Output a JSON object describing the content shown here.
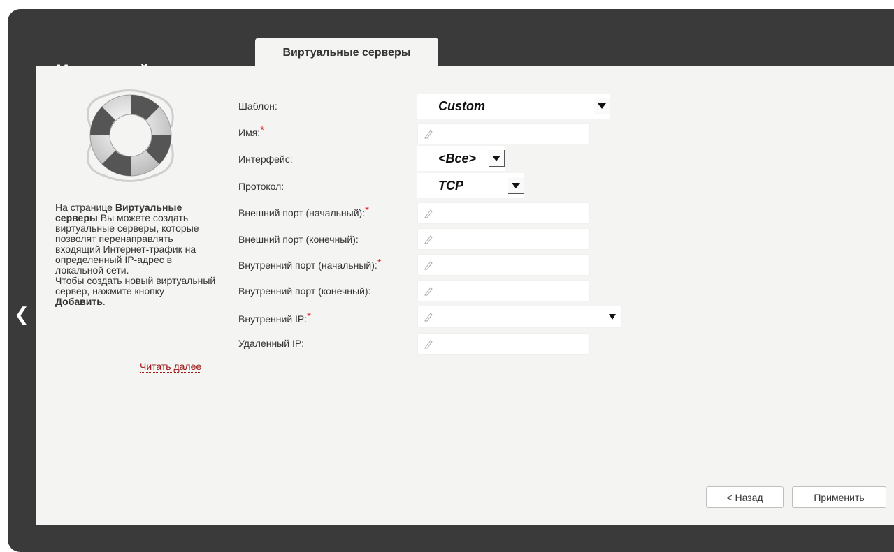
{
  "header": {
    "breadcrumb": "Межсетевой экран »",
    "tab_label": "Виртуальные серверы"
  },
  "sidebar": {
    "help_part1": "На странице ",
    "help_bold1": "Виртуальные серверы",
    "help_part2": " Вы можете создать виртуальные серверы, которые позволят перенаправлять входящий Интернет-трафик на определенный IP-адрес в локальной сети.",
    "help_part3": "Чтобы создать новый виртуальный сервер, нажмите кнопку ",
    "help_bold2": "Добавить",
    "help_part4": ".",
    "read_more": "Читать далее"
  },
  "form": {
    "template_label": "Шаблон:",
    "template_value": "Custom",
    "name_label": "Имя:",
    "name_value": "",
    "interface_label": "Интерфейс:",
    "interface_value": "<Все>",
    "protocol_label": "Протокол:",
    "protocol_value": "TCP",
    "ext_port_start_label": "Внешний порт (начальный):",
    "ext_port_start_value": "",
    "ext_port_end_label": "Внешний порт (конечный):",
    "ext_port_end_value": "",
    "int_port_start_label": "Внутренний порт (начальный):",
    "int_port_start_value": "",
    "int_port_end_label": "Внутренний порт (конечный):",
    "int_port_end_value": "",
    "internal_ip_label": "Внутренний IP:",
    "internal_ip_value": "",
    "remote_ip_label": "Удаленный IP:",
    "remote_ip_value": "",
    "required_mark": "*"
  },
  "buttons": {
    "back": "< Назад",
    "apply": "Применить"
  },
  "icons": {
    "back_arrow": "chevron-left-icon",
    "buoy": "lifebuoy-icon",
    "pencil": "pencil-icon",
    "dropdown": "triangle-down-icon"
  },
  "colors": {
    "frame": "#3a3a3a",
    "panel": "#f4f4f2",
    "required": "#e02020",
    "link": "#a01818"
  }
}
